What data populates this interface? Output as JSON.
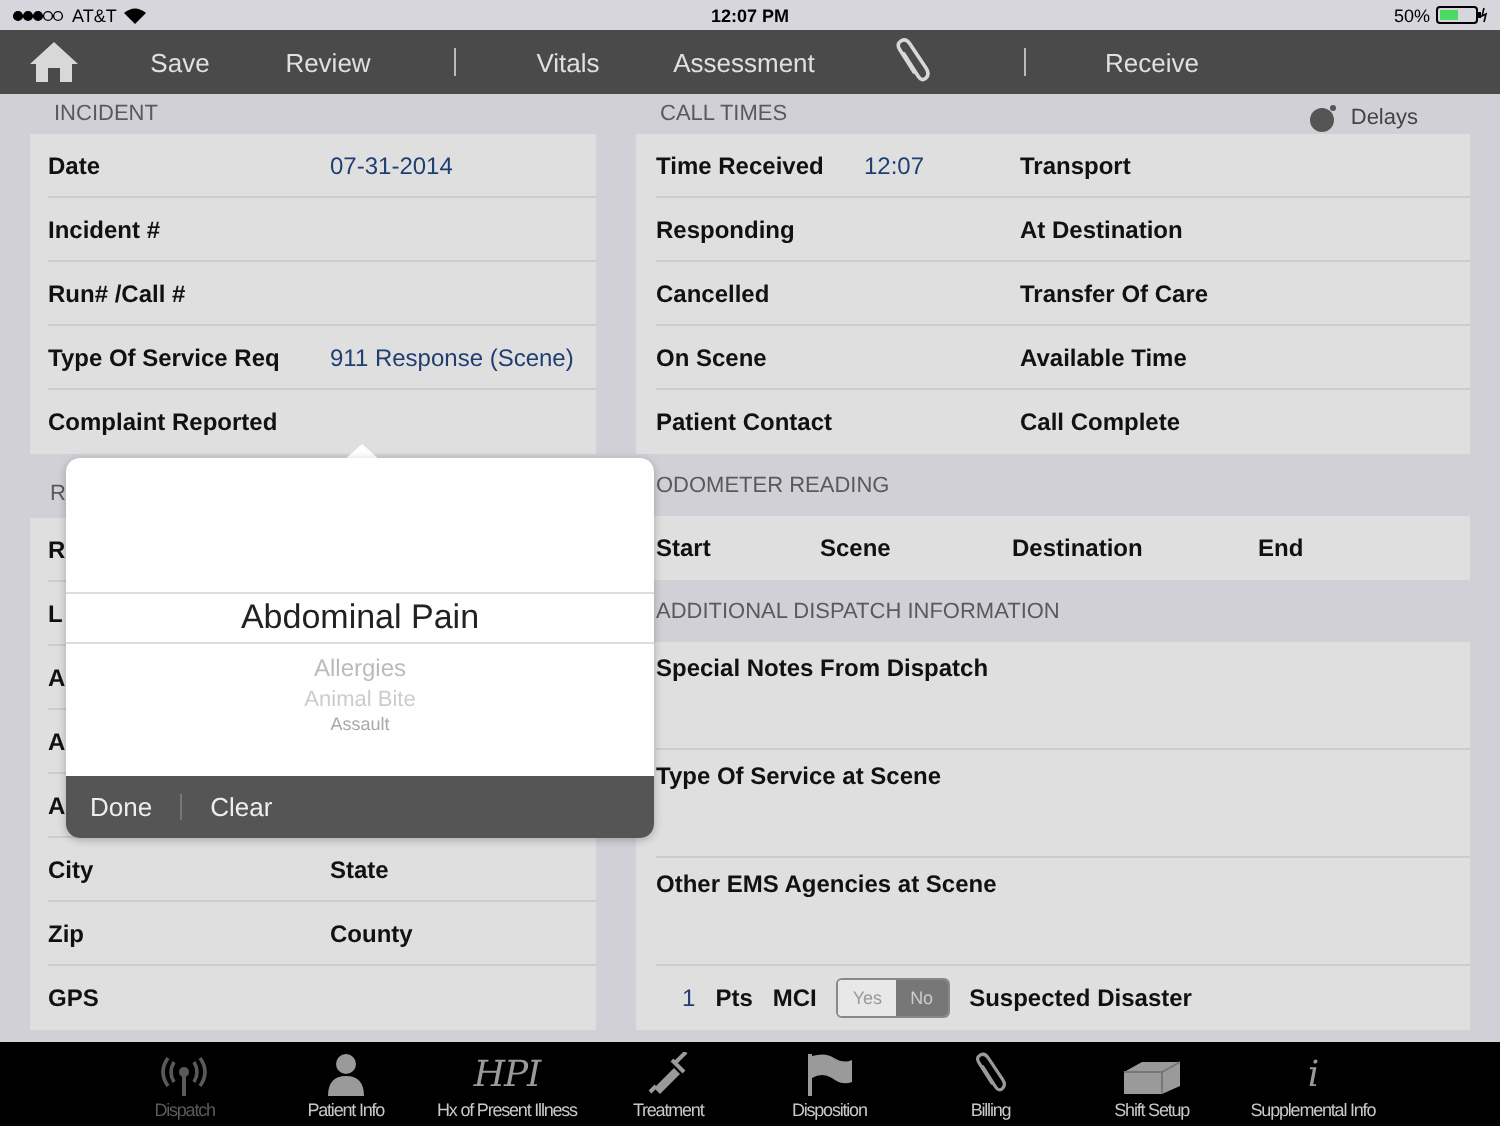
{
  "status_bar": {
    "carrier": "AT&T",
    "time": "12:07 PM",
    "battery": "50%"
  },
  "toolbar": [
    {
      "kind": "home"
    },
    {
      "kind": "text",
      "label": "Save"
    },
    {
      "kind": "text",
      "label": "Review"
    },
    {
      "kind": "divider"
    },
    {
      "kind": "text",
      "label": "Vitals"
    },
    {
      "kind": "text",
      "label": "Assessment"
    },
    {
      "kind": "clip"
    },
    {
      "kind": "divider"
    },
    {
      "kind": "text",
      "label": "Receive"
    }
  ],
  "incident": {
    "title": "INCIDENT",
    "rows": [
      {
        "label": "Date",
        "value": "07-31-2014"
      },
      {
        "label": "Incident #"
      },
      {
        "label": "Run# /Call #"
      },
      {
        "label": "Type Of Service Req",
        "value": "911 Response (Scene)"
      },
      {
        "label": "Complaint Reported"
      }
    ]
  },
  "location": {
    "title": "R",
    "rows": [
      {
        "label": "R"
      },
      {
        "label": "L"
      },
      {
        "label": "A"
      },
      {
        "label": "A"
      },
      {
        "label": "A"
      },
      {
        "label": "City",
        "second_label": "State"
      },
      {
        "label": "Zip",
        "second_label": "County"
      },
      {
        "label": "GPS"
      }
    ]
  },
  "call_times": {
    "title": "CALL TIMES",
    "delays": "Delays",
    "rows": [
      {
        "label": "Time Received",
        "value": "12:07",
        "second_label": "Transport"
      },
      {
        "label": "Responding",
        "second_label": "At Destination"
      },
      {
        "label": "Cancelled",
        "second_label": "Transfer Of Care"
      },
      {
        "label": "On Scene",
        "second_label": "Available Time"
      },
      {
        "label": "Patient Contact",
        "second_label": "Call Complete"
      }
    ]
  },
  "odometer": {
    "title": "ODOMETER READING",
    "columns": [
      "Start",
      "Scene",
      "Destination",
      "End"
    ]
  },
  "dispatch_info": {
    "title": "ADDITIONAL DISPATCH INFORMATION",
    "rows": [
      "Special Notes From Dispatch",
      "Type Of Service at Scene",
      "Other EMS Agencies at Scene"
    ],
    "patients": {
      "count": "1",
      "count_label": "Pts",
      "mci_label": "MCI",
      "options": [
        {
          "label": "Yes",
          "selected": false
        },
        {
          "label": "No",
          "selected": true
        }
      ],
      "disaster_label": "Suspected Disaster"
    }
  },
  "picker": {
    "items": [
      {
        "label": "Abdominal Pain",
        "selected": true
      },
      {
        "label": "Allergies",
        "selected": false
      },
      {
        "label": "Animal Bite",
        "selected": false
      },
      {
        "label": "Assault",
        "selected": false
      }
    ],
    "actions": [
      "Done",
      "Clear"
    ]
  },
  "tab_bar": [
    {
      "kind": "antenna",
      "label": "Dispatch",
      "selected": true
    },
    {
      "kind": "person",
      "label": "Patient Info",
      "selected": false
    },
    {
      "kind": "text",
      "icon_text": "HPI",
      "label": "Hx of Present Illness",
      "selected": false
    },
    {
      "kind": "syringe",
      "label": "Treatment",
      "selected": false
    },
    {
      "kind": "flag",
      "label": "Disposition",
      "selected": false
    },
    {
      "kind": "clip",
      "label": "Billing",
      "selected": false
    },
    {
      "kind": "box",
      "label": "Shift Setup",
      "selected": false
    },
    {
      "kind": "text",
      "icon_text": "i",
      "label": "Supplemental Info",
      "selected": false
    }
  ]
}
